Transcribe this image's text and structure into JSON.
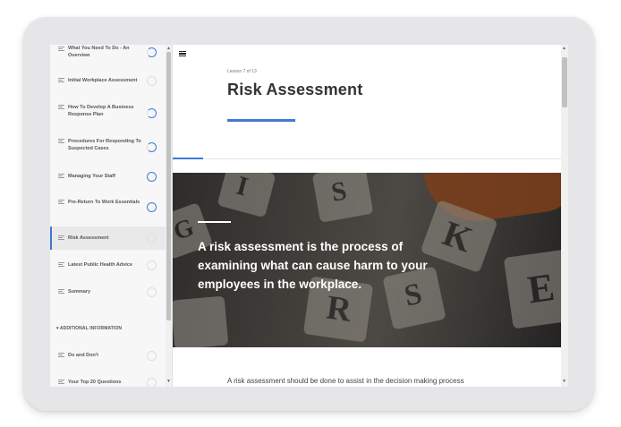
{
  "sidebar": {
    "items": [
      {
        "label": "What You Need To Do - An Overview",
        "status": "partial"
      },
      {
        "label": "Initial Workplace Assessment",
        "status": "none"
      },
      {
        "label": "How To Develop A Business Response Plan",
        "status": "partial"
      },
      {
        "label": "Procedures For Responding To Suspected Cases",
        "status": "partial"
      },
      {
        "label": "Managing Your Staff",
        "status": "full"
      },
      {
        "label": "Pre-Return To Work Essentials",
        "status": "full"
      },
      {
        "label": "Risk Assessment",
        "status": "none"
      },
      {
        "label": "Latest Public Health Advice",
        "status": "none"
      },
      {
        "label": "Summary",
        "status": "none"
      }
    ],
    "section_header": "▾ ADDITIONAL INFORMATION",
    "extra_items": [
      {
        "label": "Do and Don't",
        "status": "none"
      },
      {
        "label": "Your Top 20 Questions",
        "status": "none"
      }
    ]
  },
  "lesson": {
    "count": "Lesson 7 of 13",
    "title": "Risk Assessment",
    "hero_text": "A risk assessment is the process of examining what can cause harm to your employees in the workplace.",
    "body_text": "A risk assessment should be done to assist in the decision making process"
  },
  "icons": {
    "menu": "hamburger-menu-icon",
    "list": "list-lines-icon",
    "status": "progress-circle-icon"
  },
  "colors": {
    "accent": "#3f7ad6",
    "device_frame": "#e6e6e8"
  }
}
